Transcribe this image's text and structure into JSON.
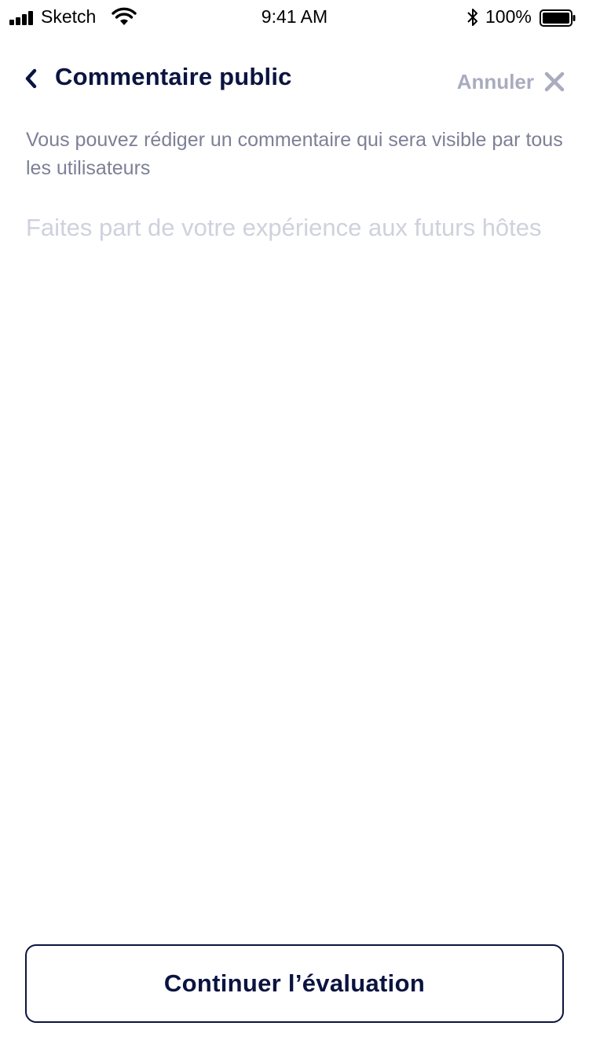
{
  "status_bar": {
    "carrier": "Sketch",
    "time": "9:41 AM",
    "battery_percent": "100%",
    "icons": [
      "signal-icon",
      "wifi-icon",
      "bluetooth-icon",
      "battery-icon"
    ]
  },
  "header": {
    "back_icon": "chevron-left-icon",
    "title": "Commentaire public",
    "cancel_label": "Annuler",
    "cancel_icon": "close-icon"
  },
  "description": "Vous pouvez rédiger un commentaire qui sera visible par tous les utilisateurs",
  "comment": {
    "value": "",
    "placeholder": "Faites part de votre expérience aux futurs hôtes"
  },
  "footer": {
    "continue_label": "Continuer l’évaluation"
  },
  "colors": {
    "primary": "#0b1440",
    "muted": "#7d8096",
    "cancel": "#a9acbf",
    "placeholder": "#cfd1dd",
    "background": "#ffffff"
  }
}
